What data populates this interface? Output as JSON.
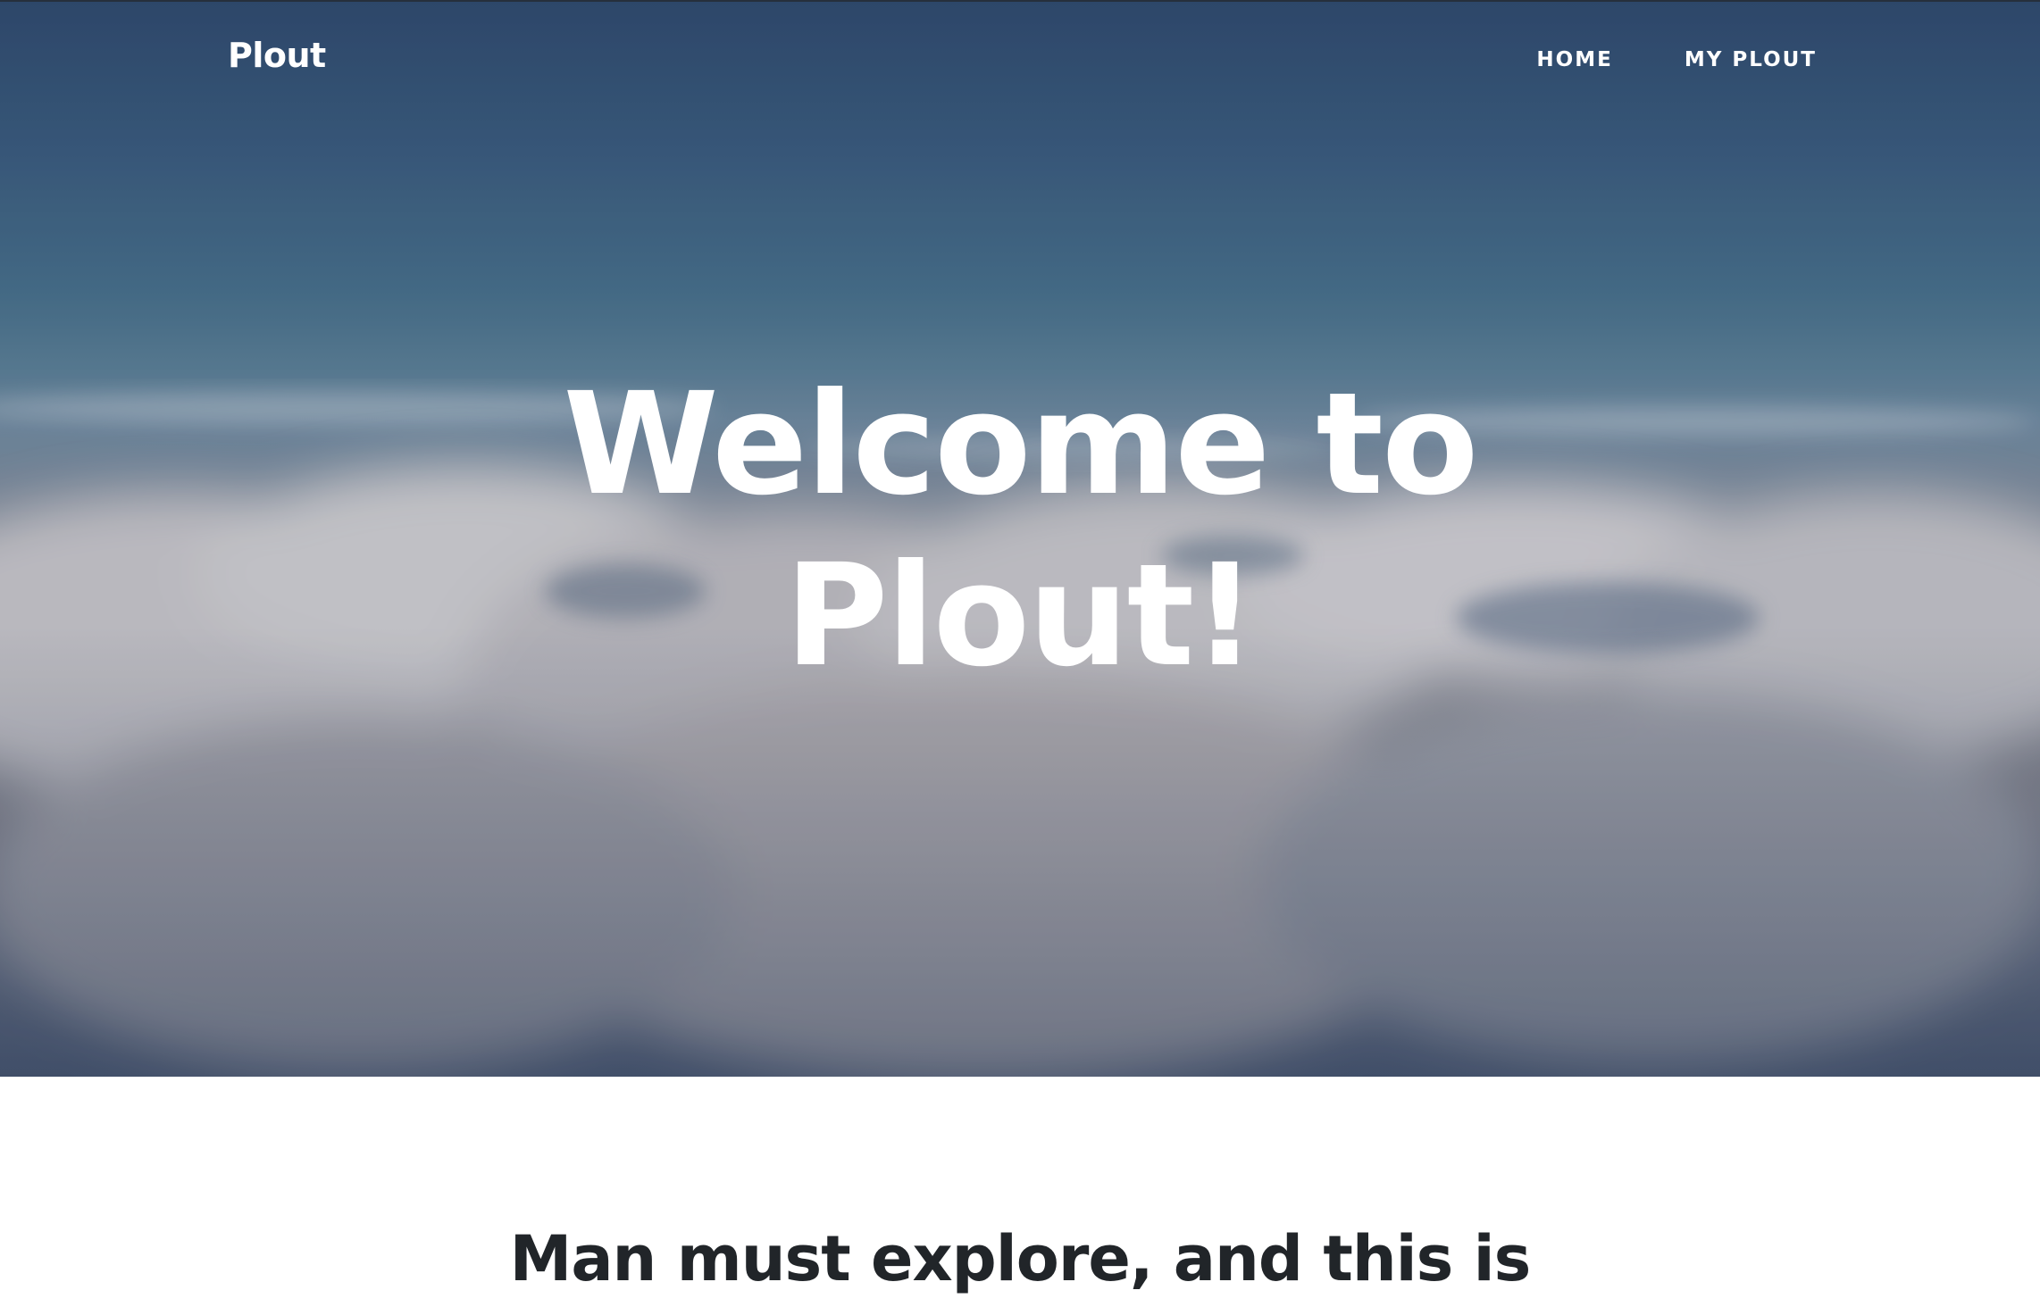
{
  "nav": {
    "brand": "Plout",
    "links": [
      {
        "label": "HOME"
      },
      {
        "label": "MY PLOUT"
      }
    ]
  },
  "hero": {
    "title_line1": "Welcome to",
    "title_line2": "Plout!",
    "background": "clouds-photo"
  },
  "intro": {
    "heading": "Man must explore, and this is"
  },
  "colors": {
    "sky_top": "#2f4b6e",
    "heading_text": "#212529",
    "nav_text": "#ffffff"
  }
}
